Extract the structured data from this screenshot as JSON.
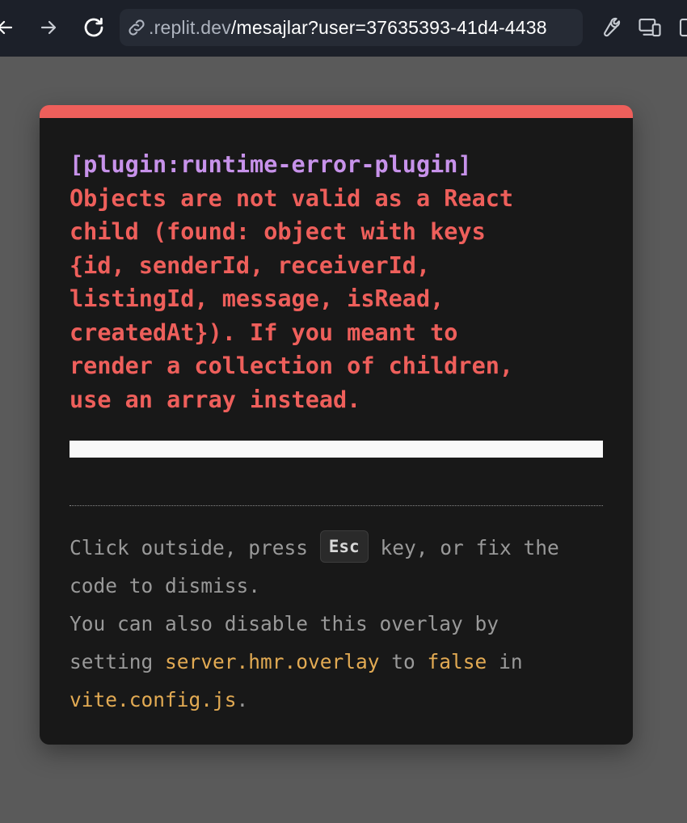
{
  "browser": {
    "url_host": ".replit.dev",
    "url_path": "/mesajlar?user=37635393-41d4-4438"
  },
  "error": {
    "plugin": "[plugin:runtime-error-plugin]",
    "lines": [
      "Objects are not valid as a React",
      "child (found: object with keys",
      "{id, senderId, receiverId,",
      "listingId, message, isRead,",
      "createdAt}). If you meant to",
      "render a collection of children,",
      "use an array instead."
    ]
  },
  "tip": {
    "part1": "Click outside, press ",
    "key": "Esc",
    "part2": " key, or fix the",
    "part3": "code to dismiss.",
    "part4": "You can also disable this overlay by",
    "part5": "setting ",
    "setting": "server.hmr.overlay",
    "part6": " to ",
    "value": "false",
    "part7": " in",
    "file": "vite.config.js",
    "part8": "."
  },
  "colors": {
    "error_red": "#ee5f5b",
    "plugin_purple": "#c792ea",
    "code_yellow": "#e2aa53",
    "card_bg": "#181818",
    "toolbar_bg": "#1c2029"
  },
  "icons": {
    "back": "arrow-left-icon",
    "forward": "arrow-right-icon",
    "reload": "reload-icon",
    "link": "link-icon",
    "devtools": "wrench-icon",
    "device": "devices-icon",
    "tabs": "window-icon"
  }
}
